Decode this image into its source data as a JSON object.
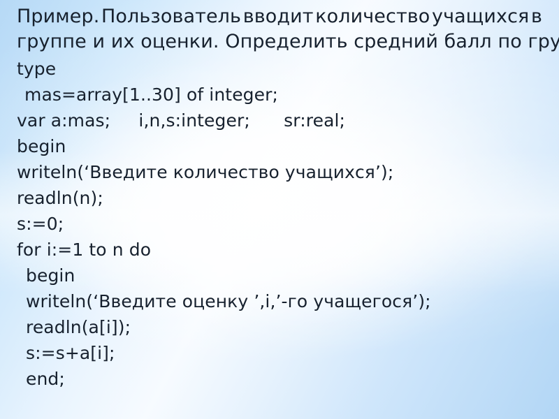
{
  "slide": {
    "background": {
      "edge_color": "#b2d6f5",
      "center_color": "#f7fbff",
      "text_color": "#17212e"
    },
    "title": {
      "line1_words": [
        "Пример.",
        "Пользователь",
        "вводит",
        "количество",
        "учащихся",
        "в"
      ],
      "line2": "группе и их оценки. Определить средний балл по группе."
    },
    "code": {
      "language": "Pascal",
      "lines": [
        {
          "text": "type",
          "indent": 0
        },
        {
          "text": "mas=array[1..30] of integer;",
          "indent": 1
        },
        {
          "text": "var a:mas;     i,n,s:integer;      sr:real;",
          "indent": 0
        },
        {
          "text": "begin",
          "indent": 0
        },
        {
          "text": "writeln(‘Введите количество учащихся’);",
          "indent": 0
        },
        {
          "text": "readln(n);",
          "indent": 0
        },
        {
          "text": "s:=0;",
          "indent": 0
        },
        {
          "text": "for i:=1 to n do",
          "indent": 0
        },
        {
          "text": "begin",
          "indent": 2
        },
        {
          "text": "writeln(‘Введите оценку ’,i,’-го учащегося’);",
          "indent": 2
        },
        {
          "text": "readln(a[i]);",
          "indent": 2
        },
        {
          "text": "s:=s+a[i];",
          "indent": 2
        },
        {
          "text": "end;",
          "indent": 2
        }
      ]
    }
  }
}
